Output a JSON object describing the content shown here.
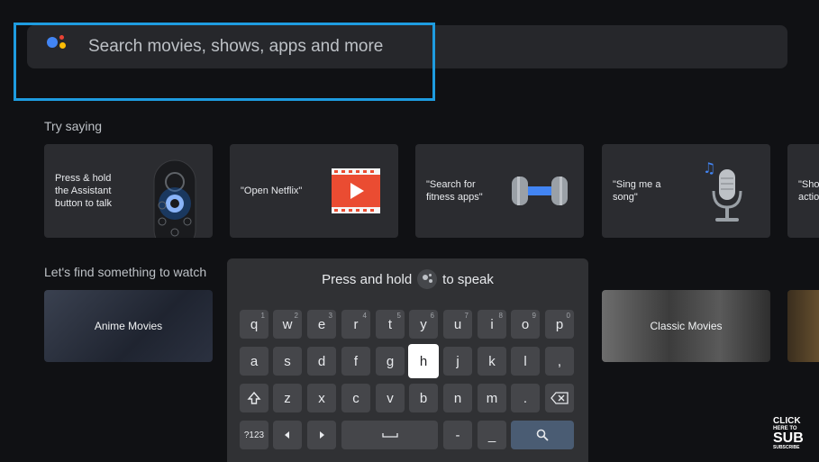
{
  "search": {
    "placeholder": "Search movies, shows, apps and more"
  },
  "try_saying": {
    "label": "Try saying",
    "cards": [
      {
        "text": "Press & hold\nthe Assistant\nbutton to talk"
      },
      {
        "text": "\"Open Netflix\""
      },
      {
        "text": "\"Search for\nfitness apps\""
      },
      {
        "text": "\"Sing me a\nsong\""
      },
      {
        "text": "\"Sho\nactio"
      }
    ]
  },
  "watch": {
    "label": "Let's find something to watch",
    "tiles": [
      {
        "label": "Anime Movies"
      },
      {
        "label": "Classic Movies"
      }
    ]
  },
  "keyboard": {
    "prompt_before": "Press and hold",
    "prompt_after": "to speak",
    "row1": [
      {
        "k": "q",
        "n": "1"
      },
      {
        "k": "w",
        "n": "2"
      },
      {
        "k": "e",
        "n": "3"
      },
      {
        "k": "r",
        "n": "4"
      },
      {
        "k": "t",
        "n": "5"
      },
      {
        "k": "y",
        "n": "6"
      },
      {
        "k": "u",
        "n": "7"
      },
      {
        "k": "i",
        "n": "8"
      },
      {
        "k": "o",
        "n": "9"
      },
      {
        "k": "p",
        "n": "0"
      }
    ],
    "row2": [
      "a",
      "s",
      "d",
      "f",
      "g",
      "h",
      "j",
      "k",
      "l",
      ","
    ],
    "row3": [
      "z",
      "x",
      "c",
      "v",
      "b",
      "n",
      "m",
      "."
    ],
    "symbols_label": "?123",
    "dash_label": "-",
    "underscore_label": "_",
    "active_key": "h"
  },
  "badge": {
    "line1": "CLICK",
    "line2": "HERE TO",
    "line3": "SUB",
    "line4": "SUBSCRIBE"
  },
  "colors": {
    "focus": "#1e9ce0",
    "background": "#101114",
    "keyboard": "#303134"
  }
}
